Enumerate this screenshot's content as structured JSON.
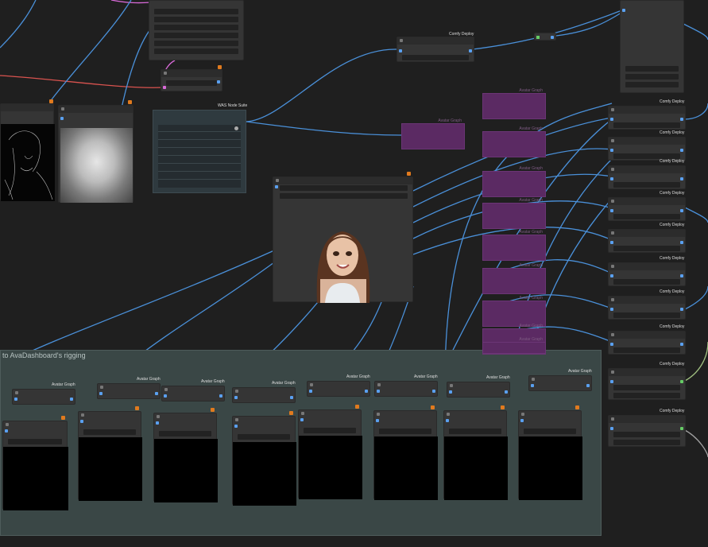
{
  "group": {
    "title": "to AvaDashboard's rigging"
  },
  "labels": {
    "comfy_deploy": "Comfy Deploy",
    "was_node_suite": "WAS Node Suite",
    "avatar_graph": "Avatar Graph"
  },
  "colors": {
    "canvas": "#1f1f1f",
    "node": "#353535",
    "wire_blue": "#4a90d9",
    "wire_red": "#d9534f",
    "wire_pink": "#d96ad9",
    "group": "#3a4746",
    "purple_node": "#5b2a63",
    "badge": "#e07a1e"
  },
  "right_column_labels": [
    "Comfy Deploy",
    "Comfy Deploy",
    "Comfy Deploy",
    "Comfy Deploy",
    "Comfy Deploy",
    "Comfy Deploy",
    "Comfy Deploy",
    "Comfy Deploy",
    "Comfy Deploy",
    "Comfy Deploy"
  ],
  "group_avatar_labels": [
    "Avatar Graph",
    "Avatar Graph",
    "Avatar Graph",
    "Avatar Graph",
    "Avatar Graph",
    "Avatar Graph",
    "Avatar Graph",
    "Avatar Graph",
    "Avatar Graph"
  ],
  "purple_labels": [
    "Avatar Graph",
    "Avatar Graph",
    "Avatar Graph",
    "Avatar Graph",
    "Avatar Graph",
    "Avatar Graph",
    "Avatar Graph",
    "Avatar Graph",
    "Avatar Graph"
  ]
}
